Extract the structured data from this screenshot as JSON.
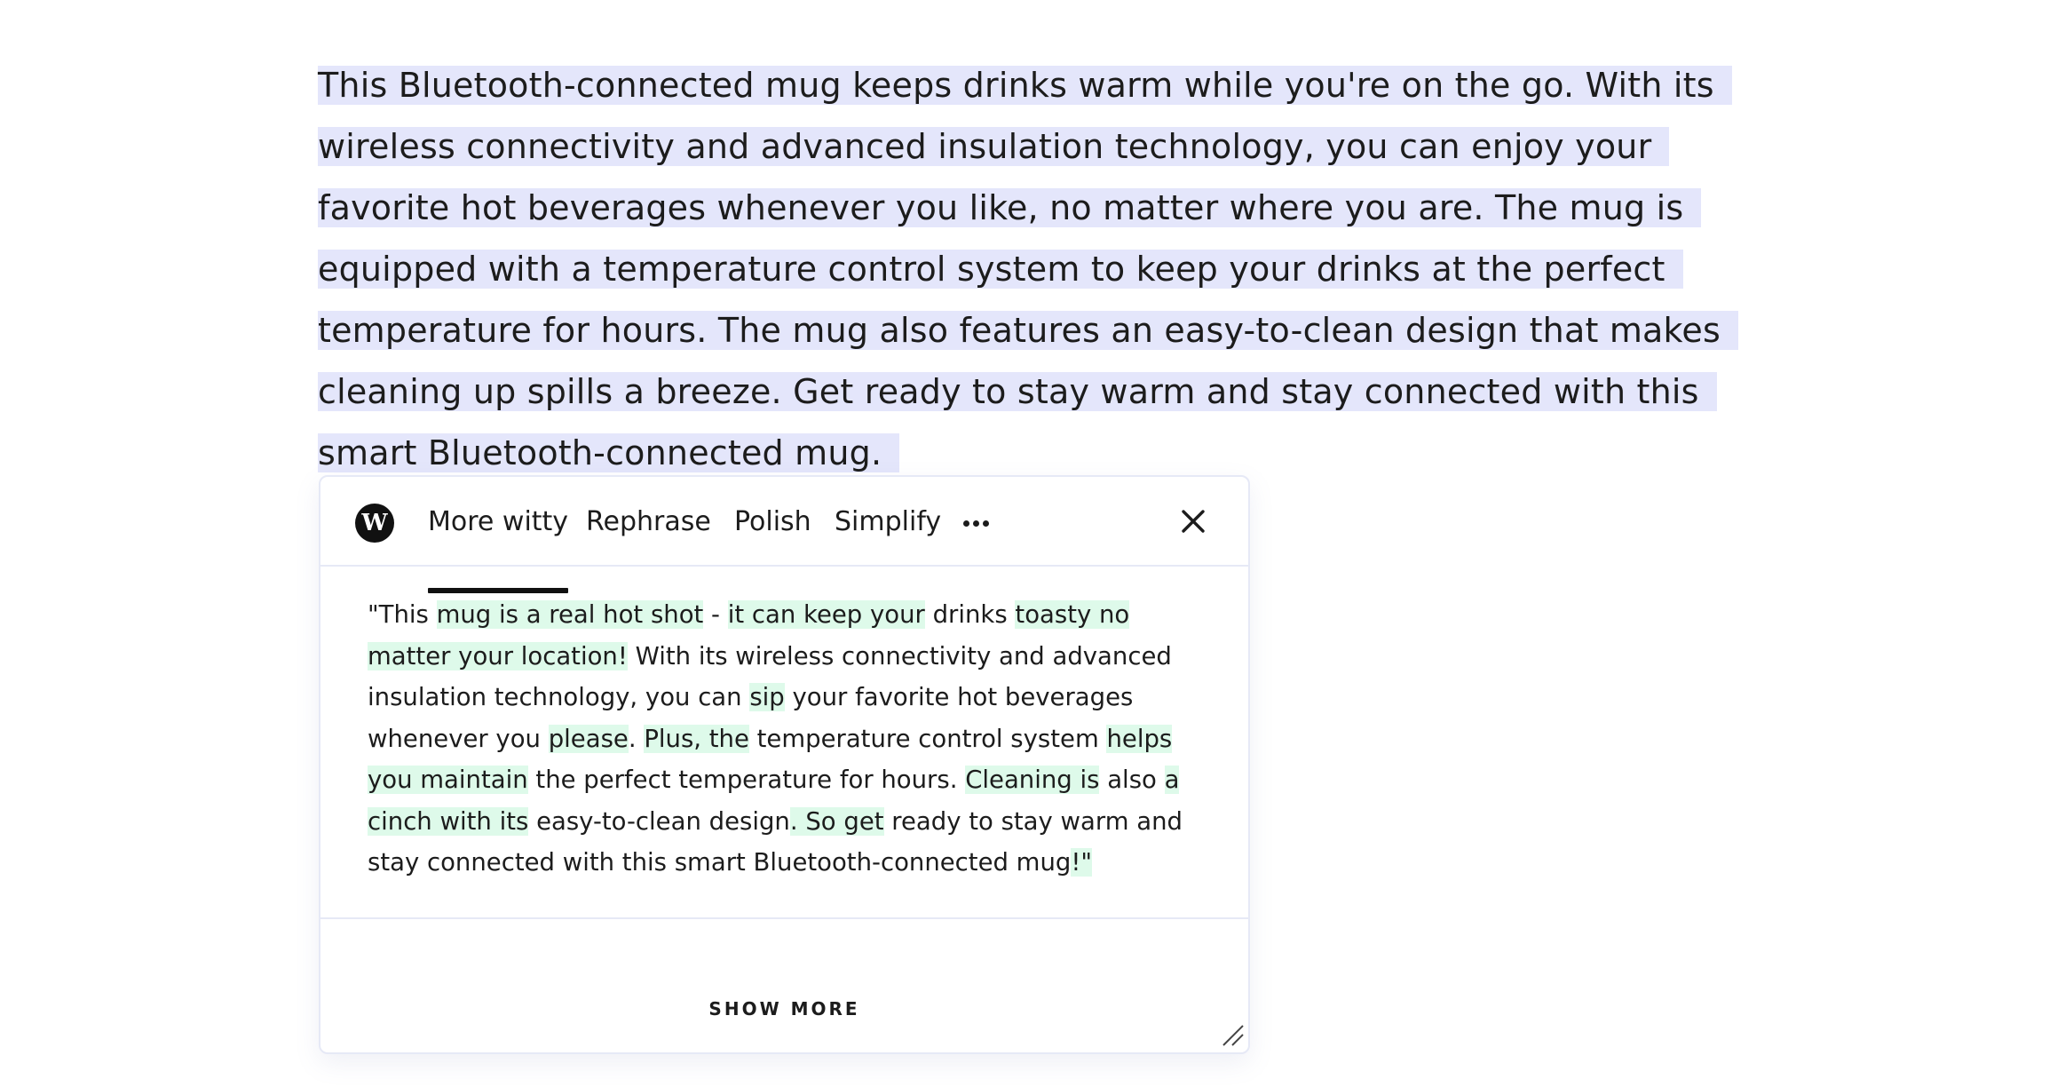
{
  "selection": {
    "lines": [
      "This Bluetooth-connected mug keeps drinks warm while you're on the go. With its",
      "wireless connectivity and advanced insulation technology, you can enjoy your",
      "favorite hot beverages whenever you like, no matter where you are. The mug is",
      "equipped with a temperature control system to keep your drinks at the perfect",
      "temperature for hours. The mug also features an easy-to-clean design that makes",
      "cleaning up spills a breeze. Get ready to stay warm and stay connected with this",
      "smart Bluetooth-connected mug."
    ],
    "highlight_color": "#e4e6fb"
  },
  "popup": {
    "logo_letter": "W",
    "tabs": [
      {
        "label": "More witty",
        "active": true
      },
      {
        "label": "Rephrase",
        "active": false
      },
      {
        "label": "Polish",
        "active": false
      },
      {
        "label": "Simplify",
        "active": false
      }
    ],
    "more_icon": "ellipsis-icon",
    "close_icon": "close-icon",
    "suggestion_segments": [
      {
        "text": "\"This ",
        "hl": false
      },
      {
        "text": "mug is a real hot shot",
        "hl": true
      },
      {
        "text": " - ",
        "hl": false
      },
      {
        "text": "it can keep your",
        "hl": true
      },
      {
        "text": " drinks ",
        "hl": false
      },
      {
        "text": "toasty no matter your location!",
        "hl": true
      },
      {
        "text": " With its wireless connectivity and advanced insulation technology, you can ",
        "hl": false
      },
      {
        "text": "sip",
        "hl": true
      },
      {
        "text": " your favorite hot beverages whenever you ",
        "hl": false
      },
      {
        "text": "please",
        "hl": true
      },
      {
        "text": ". ",
        "hl": false
      },
      {
        "text": "Plus, the",
        "hl": true
      },
      {
        "text": " temperature control system ",
        "hl": false
      },
      {
        "text": "helps you maintain",
        "hl": true
      },
      {
        "text": " the perfect temperature for hours. ",
        "hl": false
      },
      {
        "text": "Cleaning is",
        "hl": true
      },
      {
        "text": " also ",
        "hl": false
      },
      {
        "text": "a cinch with its",
        "hl": true
      },
      {
        "text": " easy-to-clean design",
        "hl": false
      },
      {
        "text": ". So get",
        "hl": true
      },
      {
        "text": " ready to stay warm and stay connected with this smart Bluetooth-connected mug",
        "hl": false
      },
      {
        "text": "!\"",
        "hl": true
      }
    ],
    "suggestion_highlight_color": "#defaea",
    "show_more_label": "SHOW MORE"
  }
}
